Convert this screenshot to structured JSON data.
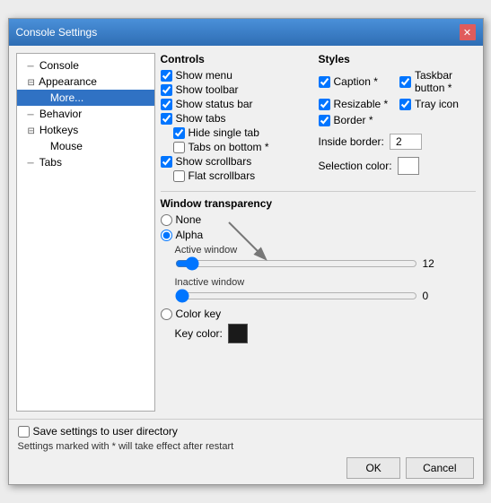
{
  "titleBar": {
    "title": "Console Settings",
    "closeLabel": "✕"
  },
  "sidebar": {
    "items": [
      {
        "id": "console",
        "label": "Console",
        "indent": 1,
        "expander": "─",
        "selected": false
      },
      {
        "id": "appearance",
        "label": "Appearance",
        "indent": 1,
        "expander": "⊟",
        "selected": false
      },
      {
        "id": "more",
        "label": "More...",
        "indent": 2,
        "expander": "",
        "selected": true
      },
      {
        "id": "behavior",
        "label": "Behavior",
        "indent": 1,
        "expander": "─",
        "selected": false
      },
      {
        "id": "hotkeys",
        "label": "Hotkeys",
        "indent": 1,
        "expander": "⊟",
        "selected": false
      },
      {
        "id": "mouse",
        "label": "Mouse",
        "indent": 2,
        "expander": "",
        "selected": false
      },
      {
        "id": "tabs",
        "label": "Tabs",
        "indent": 1,
        "expander": "─",
        "selected": false
      }
    ]
  },
  "controls": {
    "sectionLabel": "Controls",
    "checkboxes": [
      {
        "id": "show-menu",
        "label": "Show menu",
        "checked": true,
        "indent": 0
      },
      {
        "id": "show-toolbar",
        "label": "Show toolbar",
        "checked": true,
        "indent": 0
      },
      {
        "id": "show-status-bar",
        "label": "Show status bar",
        "checked": true,
        "indent": 0
      },
      {
        "id": "show-tabs",
        "label": "Show tabs",
        "checked": true,
        "indent": 0
      },
      {
        "id": "hide-single-tab",
        "label": "Hide single tab",
        "checked": true,
        "indent": 1
      },
      {
        "id": "tabs-on-bottom",
        "label": "Tabs on bottom *",
        "checked": false,
        "indent": 1
      },
      {
        "id": "show-scrollbars",
        "label": "Show scrollbars",
        "checked": true,
        "indent": 0
      },
      {
        "id": "flat-scrollbars",
        "label": "Flat scrollbars",
        "checked": false,
        "indent": 1
      }
    ]
  },
  "styles": {
    "sectionLabel": "Styles",
    "checkboxes": [
      {
        "id": "caption",
        "label": "Caption *",
        "checked": true
      },
      {
        "id": "taskbar-button",
        "label": "Taskbar button *",
        "checked": true
      },
      {
        "id": "resizable",
        "label": "Resizable *",
        "checked": true
      },
      {
        "id": "tray-icon",
        "label": "Tray icon",
        "checked": true
      },
      {
        "id": "border",
        "label": "Border *",
        "checked": true
      }
    ],
    "insideBorderLabel": "Inside border:",
    "insideBorderValue": "2",
    "selectionColorLabel": "Selection color:"
  },
  "windowTransparency": {
    "sectionLabel": "Window transparency",
    "options": [
      {
        "id": "none",
        "label": "None",
        "selected": false
      },
      {
        "id": "alpha",
        "label": "Alpha",
        "selected": true
      }
    ],
    "activeWindow": {
      "label": "Active window",
      "value": 12,
      "min": 0,
      "max": 255
    },
    "inactiveWindow": {
      "label": "Inactive window",
      "value": 0,
      "min": 0,
      "max": 255
    },
    "colorKey": {
      "label": "Color key",
      "keyColorLabel": "Key color:"
    }
  },
  "bottom": {
    "saveCheckboxLabel": "Save settings to user directory",
    "footnote": "Settings marked with * will take effect after restart",
    "okLabel": "OK",
    "cancelLabel": "Cancel"
  }
}
